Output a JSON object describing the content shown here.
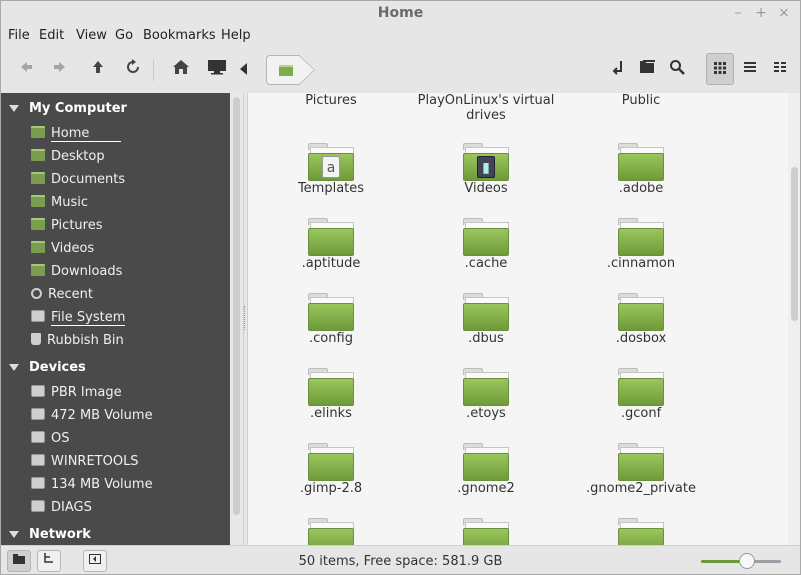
{
  "window": {
    "title": "Home",
    "controls": [
      "–",
      "+",
      "×"
    ]
  },
  "menubar": [
    "File",
    "Edit",
    "View",
    "Go",
    "Bookmarks",
    "Help"
  ],
  "toolbar": {
    "back_icon": "back-arrow-icon",
    "forward_icon": "forward-arrow-icon",
    "up_icon": "up-arrow-icon",
    "reload_icon": "reload-icon",
    "home_icon": "home-icon",
    "computer_icon": "computer-icon",
    "path_toggle_icon": "triangle-left-icon",
    "location": "Home"
  },
  "sidebar": {
    "sections": [
      {
        "title": "My Computer",
        "items": [
          {
            "label": "Home",
            "icon": "folder-home-icon",
            "selected": true
          },
          {
            "label": "Desktop",
            "icon": "folder-desktop-icon"
          },
          {
            "label": "Documents",
            "icon": "folder-documents-icon"
          },
          {
            "label": "Music",
            "icon": "folder-music-icon"
          },
          {
            "label": "Pictures",
            "icon": "folder-pictures-icon"
          },
          {
            "label": "Videos",
            "icon": "folder-videos-icon"
          },
          {
            "label": "Downloads",
            "icon": "folder-downloads-icon"
          },
          {
            "label": "Recent",
            "icon": "recent-icon"
          },
          {
            "label": "File System",
            "icon": "drive-icon",
            "underlined": true
          },
          {
            "label": "Rubbish Bin",
            "icon": "trash-icon"
          }
        ]
      },
      {
        "title": "Devices",
        "items": [
          {
            "label": "PBR Image",
            "icon": "drive-icon"
          },
          {
            "label": "472 MB Volume",
            "icon": "drive-icon"
          },
          {
            "label": "OS",
            "icon": "drive-icon"
          },
          {
            "label": "WINRETOOLS",
            "icon": "drive-icon"
          },
          {
            "label": "134 MB Volume",
            "icon": "drive-icon"
          },
          {
            "label": "DIAGS",
            "icon": "drive-icon"
          }
        ]
      },
      {
        "title": "Network",
        "items": []
      }
    ]
  },
  "files": [
    {
      "name": "Pictures",
      "emblem": ""
    },
    {
      "name": "PlayOnLinux's virtual drives",
      "emblem": ""
    },
    {
      "name": "Public",
      "emblem": ""
    },
    {
      "name": "Templates",
      "emblem": "document"
    },
    {
      "name": "Videos",
      "emblem": "film"
    },
    {
      "name": ".adobe",
      "emblem": ""
    },
    {
      "name": ".aptitude",
      "emblem": ""
    },
    {
      "name": ".cache",
      "emblem": ""
    },
    {
      "name": ".cinnamon",
      "emblem": ""
    },
    {
      "name": ".config",
      "emblem": ""
    },
    {
      "name": ".dbus",
      "emblem": ""
    },
    {
      "name": ".dosbox",
      "emblem": ""
    },
    {
      "name": ".elinks",
      "emblem": ""
    },
    {
      "name": ".etoys",
      "emblem": ""
    },
    {
      "name": ".gconf",
      "emblem": ""
    },
    {
      "name": ".gimp-2.8",
      "emblem": ""
    },
    {
      "name": ".gnome2",
      "emblem": ""
    },
    {
      "name": ".gnome2_private",
      "emblem": ""
    }
  ],
  "status": {
    "text": "50 items, Free space: 581.9 GB",
    "zoom_fraction": 0.58
  },
  "colors": {
    "sidebar_bg": "#4a4a4a",
    "folder_green": "#7fae48"
  }
}
